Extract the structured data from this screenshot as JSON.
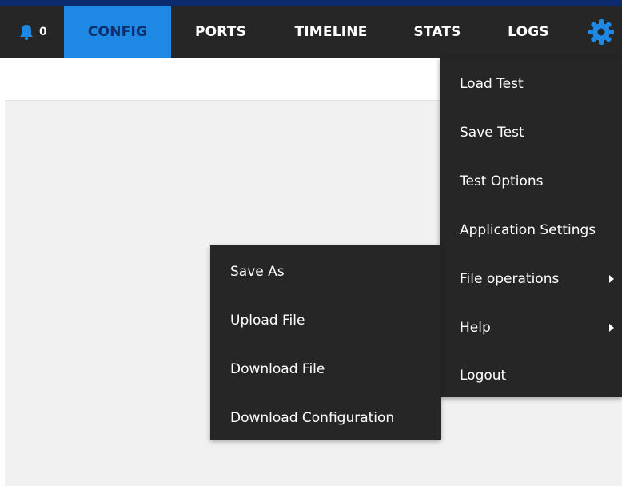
{
  "notifications": {
    "count": "0",
    "icon": "bell-icon"
  },
  "tabs": [
    {
      "label": "CONFIG",
      "active": true
    },
    {
      "label": "PORTS",
      "active": false
    },
    {
      "label": "TIMELINE",
      "active": false
    },
    {
      "label": "STATS",
      "active": false
    },
    {
      "label": "LOGS",
      "active": false
    }
  ],
  "settings": {
    "icon": "gear-icon"
  },
  "main_menu": {
    "items": [
      {
        "label": "Load Test"
      },
      {
        "label": "Save Test"
      },
      {
        "label": "Test Options"
      },
      {
        "label": "Application Settings"
      },
      {
        "label": "File operations",
        "submenu": true
      },
      {
        "label": "Help",
        "submenu": true
      },
      {
        "label": "Logout"
      }
    ]
  },
  "file_submenu": {
    "items": [
      {
        "label": "Save As"
      },
      {
        "label": "Upload File"
      },
      {
        "label": "Download File"
      },
      {
        "label": "Download Configuration"
      }
    ]
  },
  "colors": {
    "navbar": "#262626",
    "accent_bar": "#0c2a6e",
    "active_tab": "#1e88e5",
    "gear": "#1e88e5",
    "menu_bg": "#262626",
    "content_bg": "#f1f1f1"
  }
}
